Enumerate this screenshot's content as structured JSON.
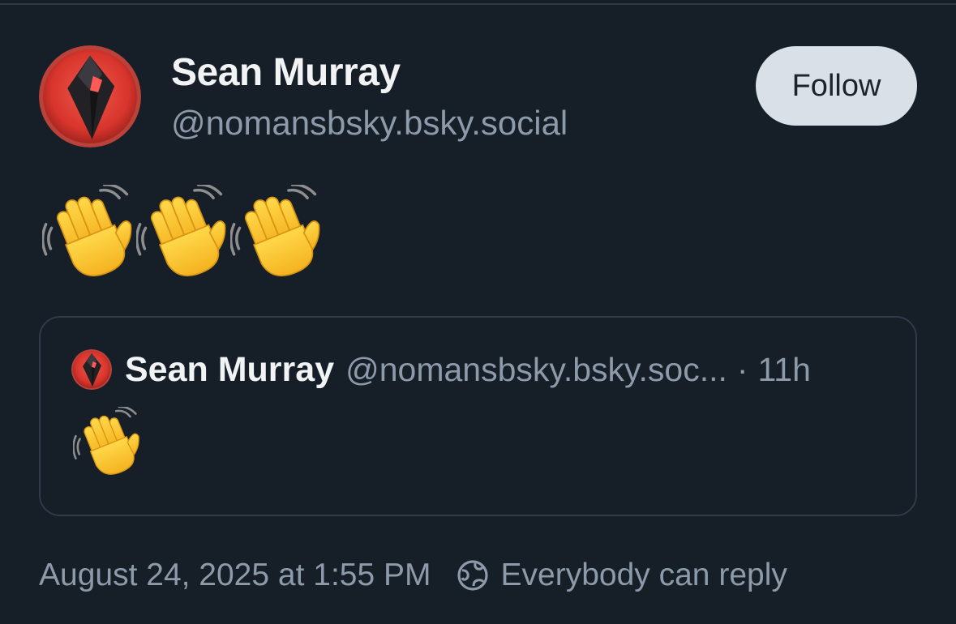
{
  "post": {
    "author": {
      "name": "Sean Murray",
      "handle": "@nomansbsky.bsky.social",
      "avatar_icon": "diamond-logo-icon"
    },
    "follow_label": "Follow",
    "body_emoji": [
      "waving-hand",
      "waving-hand",
      "waving-hand"
    ],
    "quote": {
      "name": "Sean Murray",
      "handle": "@nomansbsky.bsky.soc...",
      "separator": "·",
      "time": "11h",
      "body_emoji": [
        "waving-hand"
      ]
    },
    "timestamp": "August 24, 2025 at 1:55 PM",
    "reply_setting": "Everybody can reply",
    "reply_icon": "globe-icon"
  },
  "colors": {
    "background": "#161e27",
    "primary_text": "#f1f3f5",
    "secondary_text": "#8d9aaa",
    "follow_button_bg": "#d9e0e7",
    "border": "#2f3b48",
    "avatar_red": "#e0443a"
  }
}
